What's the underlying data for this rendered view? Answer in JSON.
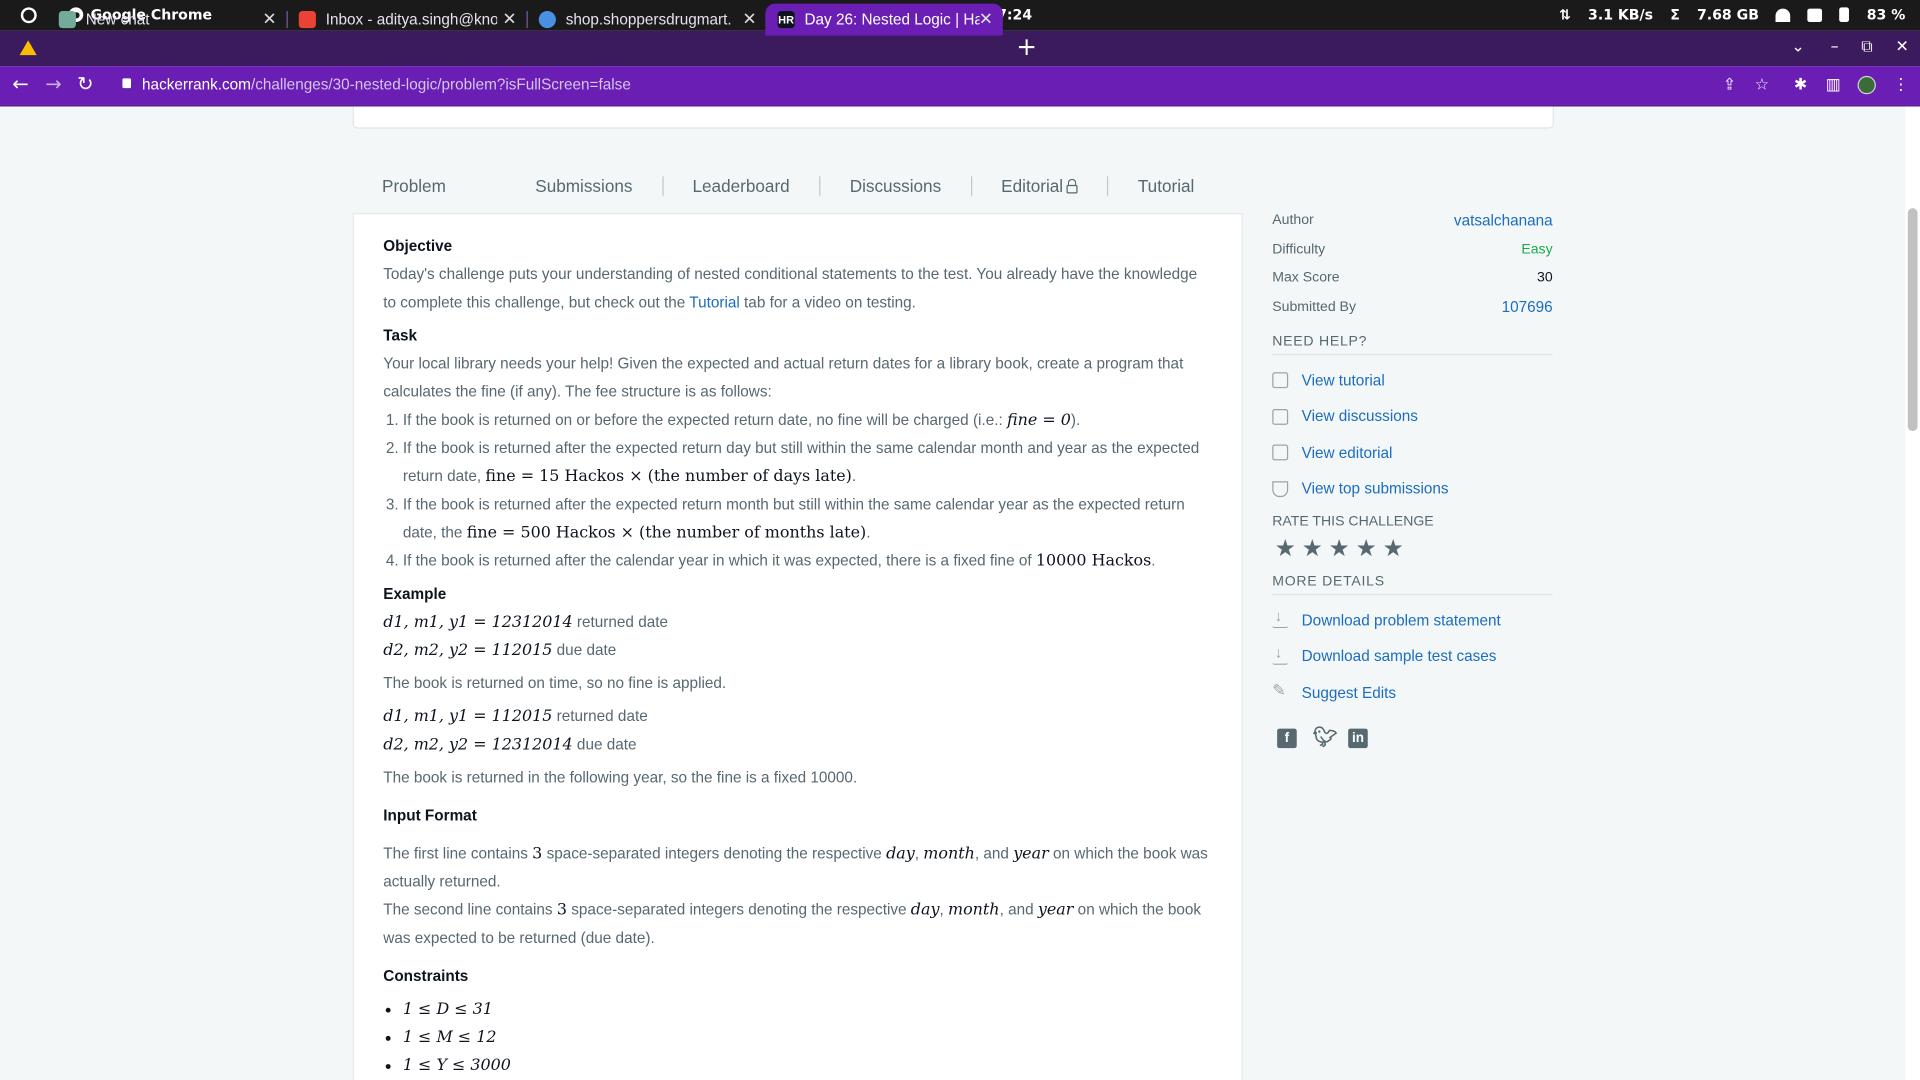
{
  "os": {
    "app_name": "Google Chrome",
    "clock": "Wed Mar 29  07:24",
    "net_speed": "3.1 KB/s",
    "memory": "7.68 GB",
    "battery": "83 %",
    "net_icon": "⇅",
    "mem_icon": "Σ"
  },
  "tabs": [
    {
      "title": "New chat",
      "favicon": "chatgpt-icon",
      "fav_color": "#74aa9c"
    },
    {
      "title": "Inbox - aditya.singh@kno",
      "favicon": "gmail-icon",
      "fav_color": "#ea4335"
    },
    {
      "title": "shop.shoppersdrugmart.",
      "favicon": "globe-icon",
      "fav_color": "#4a90e2"
    },
    {
      "title": "Day 26: Nested Logic | Ha",
      "favicon": "hackerrank-icon",
      "fav_color": "#0e141e",
      "fav_text": "HR"
    }
  ],
  "tab_close": "✕",
  "new_tab": "+",
  "window_controls": {
    "chevron": "⌄",
    "minimize": "–",
    "restore": "⧉",
    "close": "✕"
  },
  "address_bar": {
    "domain": "hackerrank.com",
    "path": "/challenges/30-nested-logic/problem?isFullScreen=false"
  },
  "nav": {
    "back": "←",
    "forward": "→",
    "reload": "↻",
    "share": "⇪",
    "bookmark": "☆",
    "extensions": "✱",
    "sidepanel": "▥",
    "menu": "⋮"
  },
  "problem_tabs": [
    "Problem",
    "Submissions",
    "Leaderboard",
    "Discussions",
    "Editorial",
    "Tutorial"
  ],
  "problem": {
    "objective_heading": "Objective",
    "objective_text_1": "Today's challenge puts your understanding of nested conditional statements to the test. You already have the knowledge to complete this challenge, but check out the",
    "objective_link": "Tutorial",
    "objective_text_2": "tab for a video on testing.",
    "task_heading": "Task",
    "task_text": "Your local library needs your help! Given the expected and actual return dates for a library book, create a program that calculates the fine (if any). The fee structure is as follows:",
    "rules": [
      {
        "text": "If the book is returned on or before the expected return date, no fine will be charged (i.e.:",
        "math": "fine = 0",
        "tail": ")."
      },
      {
        "text": "If the book is returned after the expected return day but still within the same calendar month and year as the expected return date,",
        "math": "fine = 15 Hackos × (the number of days late)",
        "tail": "."
      },
      {
        "text": "If the book is returned after the expected return month but still within the same calendar year as the expected return date, the",
        "math": "fine = 500 Hackos × (the number of months late)",
        "tail": "."
      },
      {
        "text": "If the book is returned after the calendar year in which it was expected, there is a fixed fine of",
        "math": "10000 Hackos",
        "tail": "."
      }
    ],
    "example_heading": "Example",
    "example1_line1_math": "d1, m1, y1 = 12312014",
    "example1_line1_text": "returned date",
    "example1_line2_math": "d2, m2, y2 = 112015",
    "example1_line2_text": "due date",
    "example1_result": "The book is returned on time, so no fine is applied.",
    "example2_line1_math": "d1, m1, y1 = 112015",
    "example2_line1_text": "returned date",
    "example2_line2_math": "d2, m2, y2 = 12312014",
    "example2_line2_text": "due date",
    "example2_result": "The book is returned in the following year, so the fine is a fixed 10000.",
    "input_heading": "Input Format",
    "input_line1_a": "The first line contains",
    "input_line1_n": "3",
    "input_line1_b": "space-separated integers denoting the respective",
    "input_day": "day",
    "input_month": "month",
    "input_and": ", and",
    "input_year": "year",
    "input_line1_c": "on which the book was actually returned.",
    "input_line2_a": "The second line contains",
    "input_line2_n": "3",
    "input_line2_b": "space-separated integers denoting the respective",
    "input_line2_c": "on which the book was expected to be returned (due date).",
    "constraints_heading": "Constraints",
    "constraints": [
      "1 ≤ D ≤ 31",
      "1 ≤ M ≤ 12",
      "1 ≤ Y ≤ 3000"
    ]
  },
  "sidebar": {
    "author_label": "Author",
    "author_value": "vatsalchanana",
    "difficulty_label": "Difficulty",
    "difficulty_value": "Easy",
    "maxscore_label": "Max Score",
    "maxscore_value": "30",
    "submitted_label": "Submitted By",
    "submitted_value": "107696",
    "need_help_heading": "NEED HELP?",
    "help_links": [
      "View tutorial",
      "View discussions",
      "View editorial",
      "View top submissions"
    ],
    "rate_heading": "RATE THIS CHALLENGE",
    "rating_filled": 0,
    "star_glyph": "★",
    "more_heading": "MORE DETAILS",
    "detail_links": [
      "Download problem statement",
      "Download sample test cases",
      "Suggest Edits"
    ]
  },
  "colors": {
    "accent_link": "#1c6cc1",
    "easy": "#1ba94c",
    "chrome_toolbar": "#6a1eb4",
    "tabstrip": "#3c1a5e"
  }
}
